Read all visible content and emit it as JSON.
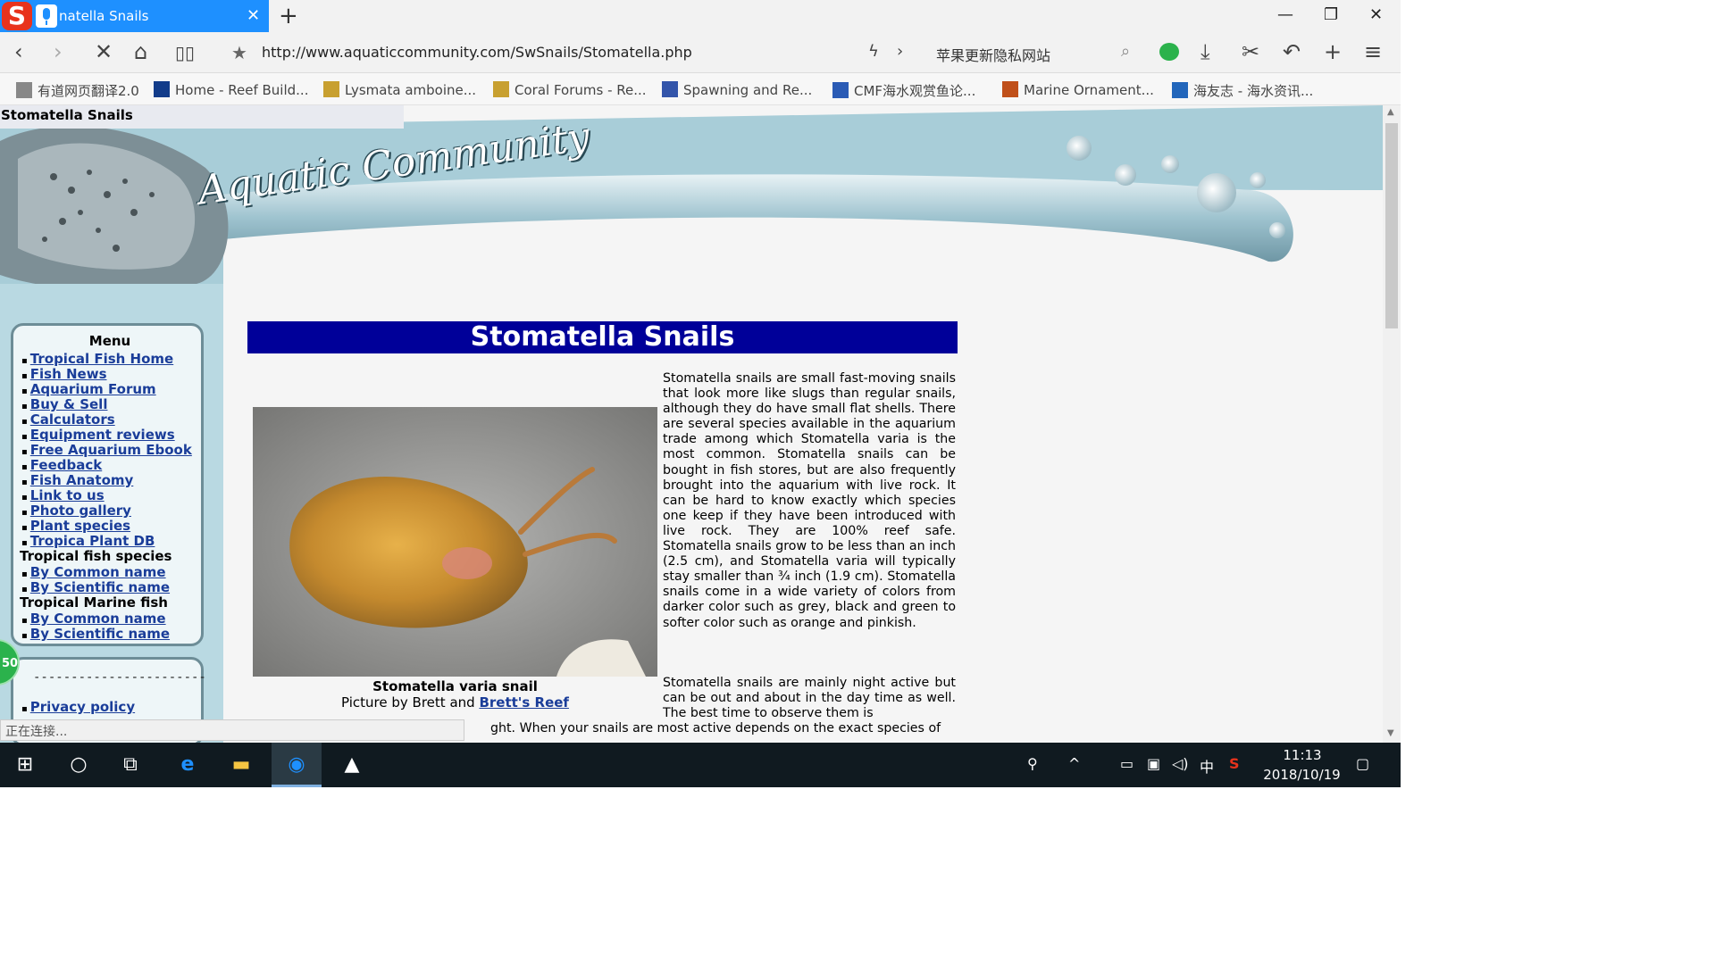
{
  "browser": {
    "tab_title": "natella Snails",
    "url": "http://www.aquaticcommunity.com/SwSnails/Stomatella.php",
    "search_hint": "苹果更新隐私网站"
  },
  "bookmarks": [
    {
      "label": "有道网页翻译2.0",
      "icon": "page-icon",
      "color": "#888888"
    },
    {
      "label": "Home - Reef Build...",
      "icon": "rb-icon",
      "color": "#123c8a"
    },
    {
      "label": "Lysmata amboine...",
      "icon": "leaf-icon",
      "color": "#c8a030"
    },
    {
      "label": "Coral Forums - Re...",
      "icon": "leaf-icon",
      "color": "#c8a030"
    },
    {
      "label": "Spawning and Re...",
      "icon": "rk-icon",
      "color": "#3355aa"
    },
    {
      "label": "CMF海水观赏鱼论...",
      "icon": "cmf-icon",
      "color": "#2a5bb5"
    },
    {
      "label": "Marine Ornament...",
      "icon": "marine-icon",
      "color": "#c0501a"
    },
    {
      "label": "海友志 - 海水资讯...",
      "icon": "search-q-icon",
      "color": "#2266bb"
    }
  ],
  "page": {
    "window_title": "Stomatella Snails",
    "site_logo": "Aquatic Community",
    "title": "Stomatella Snails",
    "menu": {
      "heading": "Menu",
      "links": [
        "Tropical Fish Home",
        "Fish News",
        "Aquarium Forum",
        "Buy & Sell",
        "Calculators",
        "Equipment reviews",
        "Free Aquarium Ebook",
        "Feedback",
        "Fish Anatomy",
        "Link to us",
        "Photo gallery",
        "Plant species",
        "Tropica Plant DB"
      ],
      "section_tropical": "Tropical fish species",
      "tropical_links": [
        "By Common name",
        "By Scientific name"
      ],
      "section_marine": "Tropical Marine fish",
      "marine_links": [
        "By Common name",
        "By Scientific name"
      ],
      "divider": "-----------------------",
      "privacy": "Privacy policy"
    },
    "photo_caption": "Stomatella varia snail",
    "photo_credit_prefix": "Picture by Brett and ",
    "photo_credit_link": "Brett's Reef",
    "para1": "Stomatella snails are small fast-moving snails that look more like slugs than regular snails, although they do have small flat shells. There are several species available in the aquarium trade among which Stomatella varia is the most common. Stomatella snails can be bought in fish stores, but are also frequently brought into the aquarium with live rock. It can be hard to know exactly which species one keep if they have been introduced with live rock. They are 100% reef safe. Stomatella snails grow to be less than an inch (2.5 cm), and Stomatella varia will typically stay smaller than ¾ inch (1.9 cm). Stomatella snails come in a wide variety of colors from darker color such as grey, black and green to softer color such as orange and pinkish.",
    "para2": "Stomatella snails are mainly night active but can be out and about in the day time as well. The best time to observe them is",
    "para3": "ght. When your snails are most active depends on the exact species of",
    "badge": "50",
    "status": "正在连接..."
  },
  "taskbar": {
    "time": "11:13",
    "date": "2018/10/19",
    "ime": "中"
  }
}
